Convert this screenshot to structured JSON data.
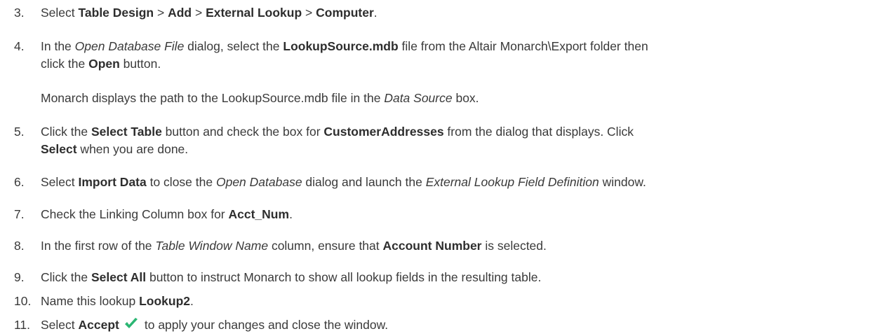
{
  "steps": [
    {
      "num": "3.",
      "parts": [
        {
          "t": "Select ",
          "s": "n"
        },
        {
          "t": "Table Design",
          "s": "b"
        },
        {
          "t": " > ",
          "s": "n"
        },
        {
          "t": "Add",
          "s": "b"
        },
        {
          "t": " > ",
          "s": "n"
        },
        {
          "t": "External Lookup",
          "s": "b"
        },
        {
          "t": " > ",
          "s": "n"
        },
        {
          "t": "Computer",
          "s": "b"
        },
        {
          "t": ".",
          "s": "n"
        }
      ]
    },
    {
      "num": "4.",
      "line1": [
        {
          "t": "In the ",
          "s": "n"
        },
        {
          "t": "Open Database File",
          "s": "i"
        },
        {
          "t": " dialog, select the ",
          "s": "n"
        },
        {
          "t": "LookupSource.mdb",
          "s": "b"
        },
        {
          "t": " file from the Altair Monarch\\Export folder then",
          "s": "n"
        }
      ],
      "line2": [
        {
          "t": "click the ",
          "s": "n"
        },
        {
          "t": "Open",
          "s": "b"
        },
        {
          "t": " button.",
          "s": "n"
        }
      ]
    },
    {
      "note": [
        {
          "t": "Monarch displays the path to the LookupSource.mdb file in the ",
          "s": "n"
        },
        {
          "t": "Data Source",
          "s": "i"
        },
        {
          "t": " box.",
          "s": "n"
        }
      ]
    },
    {
      "num": "5.",
      "line1": [
        {
          "t": "Click the ",
          "s": "n"
        },
        {
          "t": "Select Table",
          "s": "b"
        },
        {
          "t": " button and check the box for ",
          "s": "n"
        },
        {
          "t": "CustomerAddresses",
          "s": "b"
        },
        {
          "t": " from the dialog that displays. Click",
          "s": "n"
        }
      ],
      "line2": [
        {
          "t": "Select",
          "s": "b"
        },
        {
          "t": " when you are done.",
          "s": "n"
        }
      ]
    },
    {
      "num": "6.",
      "parts": [
        {
          "t": "Select ",
          "s": "n"
        },
        {
          "t": "Import Data",
          "s": "b"
        },
        {
          "t": " to close the ",
          "s": "n"
        },
        {
          "t": "Open Database",
          "s": "i"
        },
        {
          "t": " dialog and launch the ",
          "s": "n"
        },
        {
          "t": "External Lookup Field Definition",
          "s": "i"
        },
        {
          "t": " window.",
          "s": "n"
        }
      ]
    },
    {
      "num": "7.",
      "parts": [
        {
          "t": "Check the Linking Column box for ",
          "s": "n"
        },
        {
          "t": "Acct_Num",
          "s": "b"
        },
        {
          "t": ".",
          "s": "n"
        }
      ]
    },
    {
      "num": "8.",
      "parts": [
        {
          "t": "In the first row of the ",
          "s": "n"
        },
        {
          "t": "Table Window Name",
          "s": "i"
        },
        {
          "t": " column, ensure that ",
          "s": "n"
        },
        {
          "t": "Account Number",
          "s": "b"
        },
        {
          "t": " is selected.",
          "s": "n"
        }
      ]
    },
    {
      "num": "9.",
      "parts": [
        {
          "t": "Click the ",
          "s": "n"
        },
        {
          "t": "Select All",
          "s": "b"
        },
        {
          "t": " button to instruct Monarch to show all lookup fields in the resulting table.",
          "s": "n"
        }
      ]
    },
    {
      "num": "10.",
      "parts": [
        {
          "t": "Name this lookup ",
          "s": "n"
        },
        {
          "t": "Lookup2",
          "s": "b"
        },
        {
          "t": ".",
          "s": "n"
        }
      ]
    },
    {
      "num": "11.",
      "parts": [
        {
          "t": "Select ",
          "s": "n"
        },
        {
          "t": "Accept",
          "s": "b"
        },
        {
          "t": "",
          "s": "icon"
        },
        {
          "t": "to apply your changes and close the window.",
          "s": "n"
        }
      ]
    }
  ],
  "icons": {
    "accept_icon": "checkmark-icon",
    "accept_color": "#2bb673"
  }
}
